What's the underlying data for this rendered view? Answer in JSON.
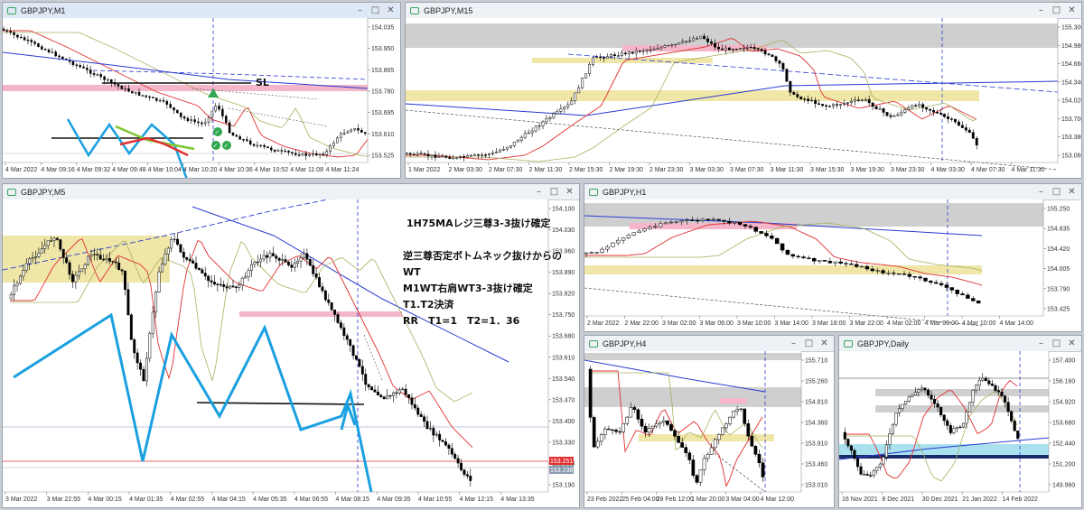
{
  "windows": {
    "m1": {
      "title": "GBPJPY,M1",
      "price_labels": [
        "154.035",
        "153.950",
        "153.865",
        "153.780",
        "153.695",
        "153.610",
        "153.525"
      ],
      "time_labels": [
        "4 Mar 2022",
        "4 Mar 09:16",
        "4 Mar 09:32",
        "4 Mar 09:48",
        "4 Mar 10:04",
        "4 Mar 10:20",
        "4 Mar 10:36",
        "4 Mar 10:52",
        "4 Mar 11:08",
        "4 Mar 11:24"
      ],
      "sl_label": "SL"
    },
    "m15": {
      "title": "GBPJPY,M15",
      "price_labels": [
        "155.300",
        "154.980",
        "154.660",
        "154.340",
        "154.020",
        "153.700",
        "153.380",
        "153.060"
      ],
      "time_labels": [
        "1 Mar 2022",
        "2 Mar 03:30",
        "2 Mar 07:30",
        "2 Mar 11:30",
        "2 Mar 15:30",
        "2 Mar 19:30",
        "2 Mar 23:30",
        "3 Mar 03:30",
        "3 Mar 07:30",
        "3 Mar 11:30",
        "3 Mar 15:30",
        "3 Mar 19:30",
        "3 Mar 23:30",
        "4 Mar 03:30",
        "4 Mar 07:30",
        "4 Mar 11:30"
      ]
    },
    "m5": {
      "title": "GBPJPY,M5",
      "price_labels": [
        "154.100",
        "154.030",
        "153.960",
        "153.890",
        "153.820",
        "153.750",
        "153.680",
        "153.610",
        "153.540",
        "153.470",
        "153.400",
        "153.330",
        "153.260",
        "153.190"
      ],
      "current_prices": [
        "153.251",
        "153.238"
      ],
      "time_labels": [
        "3 Mar 2022",
        "3 Mar 22:55",
        "4 Mar 00:15",
        "4 Mar 01:35",
        "4 Mar 02:55",
        "4 Mar 04:15",
        "4 Mar 05:35",
        "4 Mar 06:55",
        "4 Mar 08:15",
        "4 Mar 09:35",
        "4 Mar 10:55",
        "4 Mar 12:15",
        "4 Mar 13:35"
      ],
      "annotations": [
        "1H75MAレジ三尊3-3抜け確定",
        "逆三尊否定ボトムネック抜けからの",
        "WT",
        "M1WT右肩WT3-3抜け確定",
        "T1.T2決済",
        "RR　T1=1　T2=1．36"
      ]
    },
    "h1": {
      "title": "GBPJPY,H1",
      "price_labels": [
        "155.250",
        "154.835",
        "154.420",
        "154.005",
        "153.790",
        "153.425"
      ],
      "time_labels": [
        "2 Mar 2022",
        "2 Mar 22:00",
        "3 Mar 02:00",
        "3 Mar 06:00",
        "3 Mar 10:00",
        "3 Mar 14:00",
        "3 Mar 18:00",
        "3 Mar 22:00",
        "4 Mar 02:00",
        "4 Mar 06:00",
        "4 Mar 10:00",
        "4 Mar 14:00"
      ]
    },
    "h4": {
      "title": "GBPJPY,H4",
      "price_labels": [
        "155.710",
        "155.260",
        "154.810",
        "154.360",
        "153.910",
        "153.460",
        "153.010"
      ],
      "time_labels": [
        "23 Feb 2022",
        "25 Feb 04:00",
        "28 Feb 12:00",
        "1 Mar 20:00",
        "3 Mar 04:00",
        "4 Mar 12:00"
      ]
    },
    "daily": {
      "title": "GBPJPY,Daily",
      "price_labels": [
        "157.400",
        "156.160",
        "154.920",
        "153.680",
        "152.440",
        "151.200",
        "149.960"
      ],
      "time_labels": [
        "16 Nov 2021",
        "8 Dec 2021",
        "30 Dec 2021",
        "21 Jan 2022",
        "14 Feb 2022"
      ]
    }
  },
  "colors": {
    "bull": "#ffffff",
    "bear": "#000000",
    "pink": "#f4b6c8",
    "yellow": "#efe6a8",
    "gray": "#cfcfcf",
    "cyan": "#a9e2ee",
    "blue_ma": "#2a3bd1",
    "red_ma": "#e03030",
    "olive_ma": "#a8b060",
    "annotation": "#111111",
    "wave": "#1aa0e0"
  }
}
